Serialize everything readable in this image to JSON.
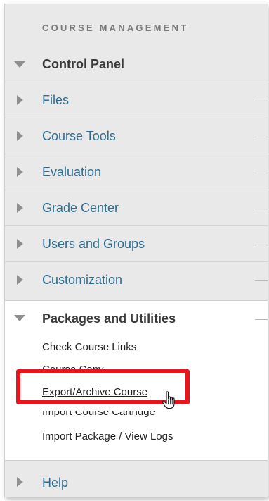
{
  "panel": {
    "heading": "COURSE MANAGEMENT",
    "control_panel": "Control Panel",
    "items": [
      {
        "label": "Files"
      },
      {
        "label": "Course Tools"
      },
      {
        "label": "Evaluation"
      },
      {
        "label": "Grade Center"
      },
      {
        "label": "Users and Groups"
      },
      {
        "label": "Customization"
      }
    ],
    "packages": {
      "label": "Packages and Utilities",
      "links": [
        {
          "label": "Check Course Links"
        },
        {
          "label": "Course Copy"
        },
        {
          "label": "Export/Archive Course"
        },
        {
          "label": "Import Course Cartridge"
        },
        {
          "label": "Import Package / View Logs"
        }
      ]
    },
    "help": "Help"
  },
  "colors": {
    "link": "#2d6e92",
    "highlight": "#e8151c",
    "panel_bg": "#e9e9e9"
  }
}
